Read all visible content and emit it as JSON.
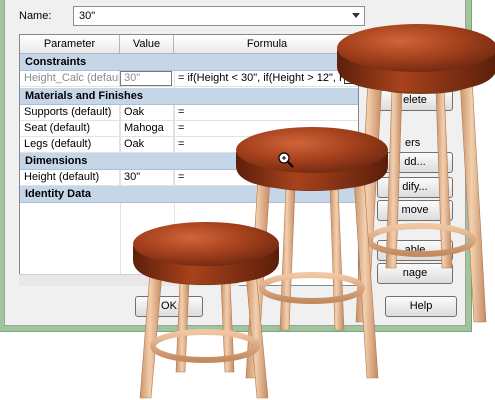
{
  "dialog": {
    "name_label": "Name:",
    "name_value": "30\"",
    "columns": {
      "parameter": "Parameter",
      "value": "Value",
      "formula": "Formula"
    },
    "groups": {
      "constraints": "Constraints",
      "materials": "Materials and Finishes",
      "dimensions": "Dimensions",
      "identity": "Identity Data"
    },
    "rows": {
      "height_calc": {
        "param": "Height_Calc (default)",
        "value": "30\"",
        "formula": "= if(Height < 30\", if(Height > 12\", Heig"
      },
      "supports": {
        "param": "Supports (default)",
        "value": "Oak",
        "formula": "="
      },
      "seat": {
        "param": "Seat (default)",
        "value": "Mahoga",
        "formula": "="
      },
      "legs": {
        "param": "Legs (default)",
        "value": "Oak",
        "formula": "="
      },
      "height": {
        "param": "Height (default)",
        "value": "30\"",
        "formula": "="
      }
    },
    "buttons": {
      "delete": "elete",
      "parameters_label": "ers",
      "add": "dd...",
      "modify": "dify...",
      "remove": "move",
      "table": "able",
      "manage": "nage",
      "ok": "OK",
      "help": "Help"
    }
  },
  "colors": {
    "dialog_frame": "#9fc59a",
    "group_header": "#c6d6e9",
    "seat_wood": "#b3471d",
    "leg_wood": "#e8b98e"
  },
  "icons": {
    "cursor": "magnify-cursor-icon"
  }
}
